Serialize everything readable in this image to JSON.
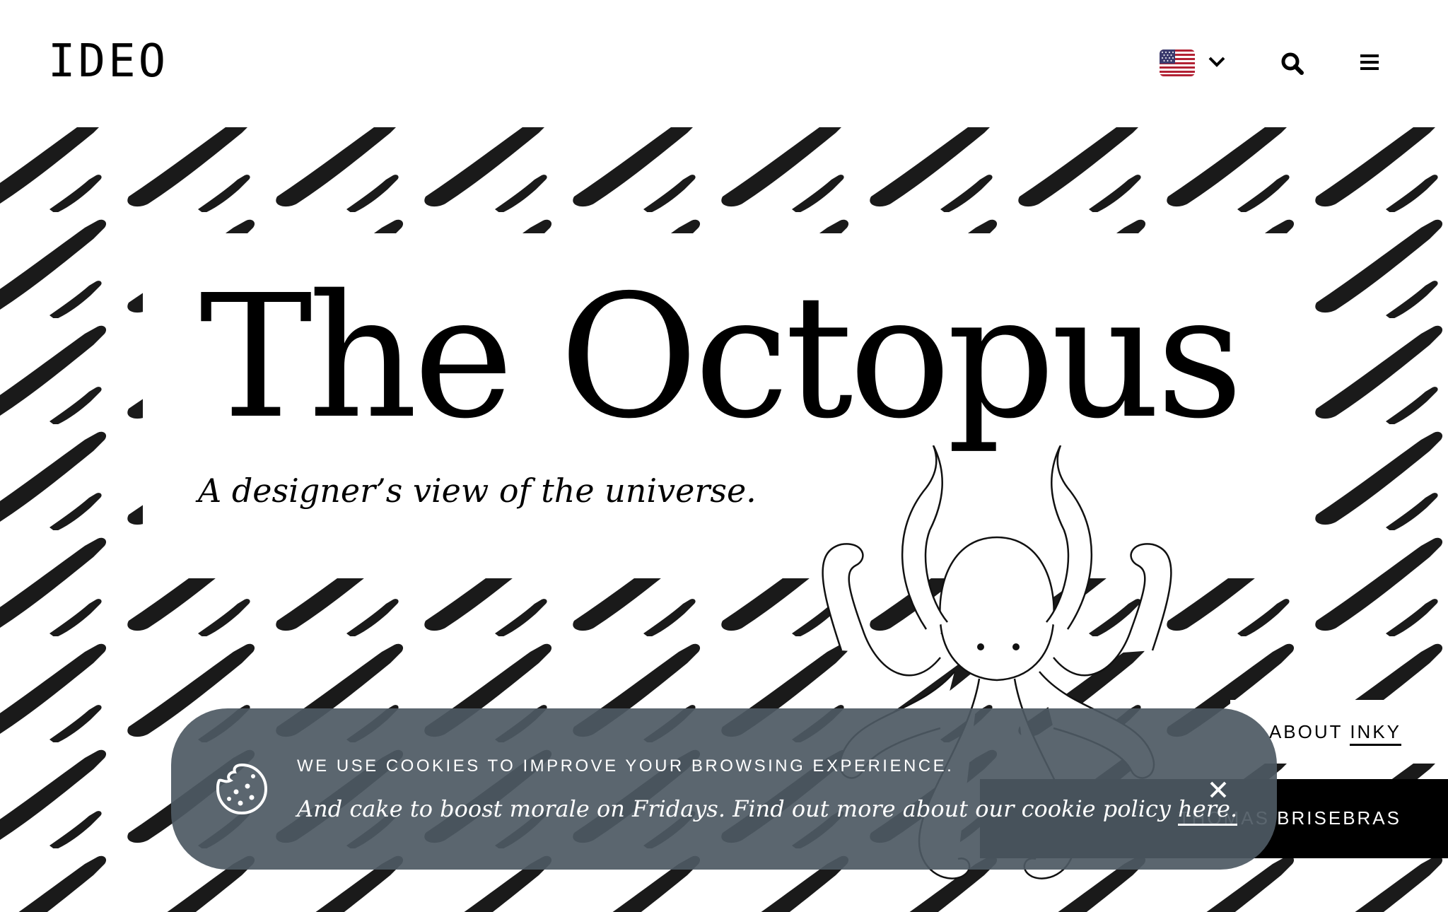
{
  "header": {
    "logo": "IDEO",
    "region_flag": "us-flag-icon",
    "icons": [
      "chevron-down-icon",
      "search-icon",
      "hamburger-menu-icon"
    ]
  },
  "hero": {
    "title": "The Octopus",
    "subtitle": "A designer’s view of the universe.",
    "about_prefix": "ABOUT",
    "about_link": "INKY",
    "author": "THOMAS BRISEBRAS"
  },
  "cookie_banner": {
    "heading": "WE USE COOKIES TO IMPROVE YOUR BROWSING EXPERIENCE.",
    "body": "And cake to boost morale on Fridays. Find out more about our cookie policy",
    "link": "here.",
    "icons": [
      "cookie-icon",
      "close-icon"
    ]
  },
  "colors": {
    "banner_bg": "#4d5963",
    "ink": "#000000",
    "page_bg": "#ffffff",
    "flag_red": "#b22234",
    "flag_blue": "#3c3b6e"
  }
}
